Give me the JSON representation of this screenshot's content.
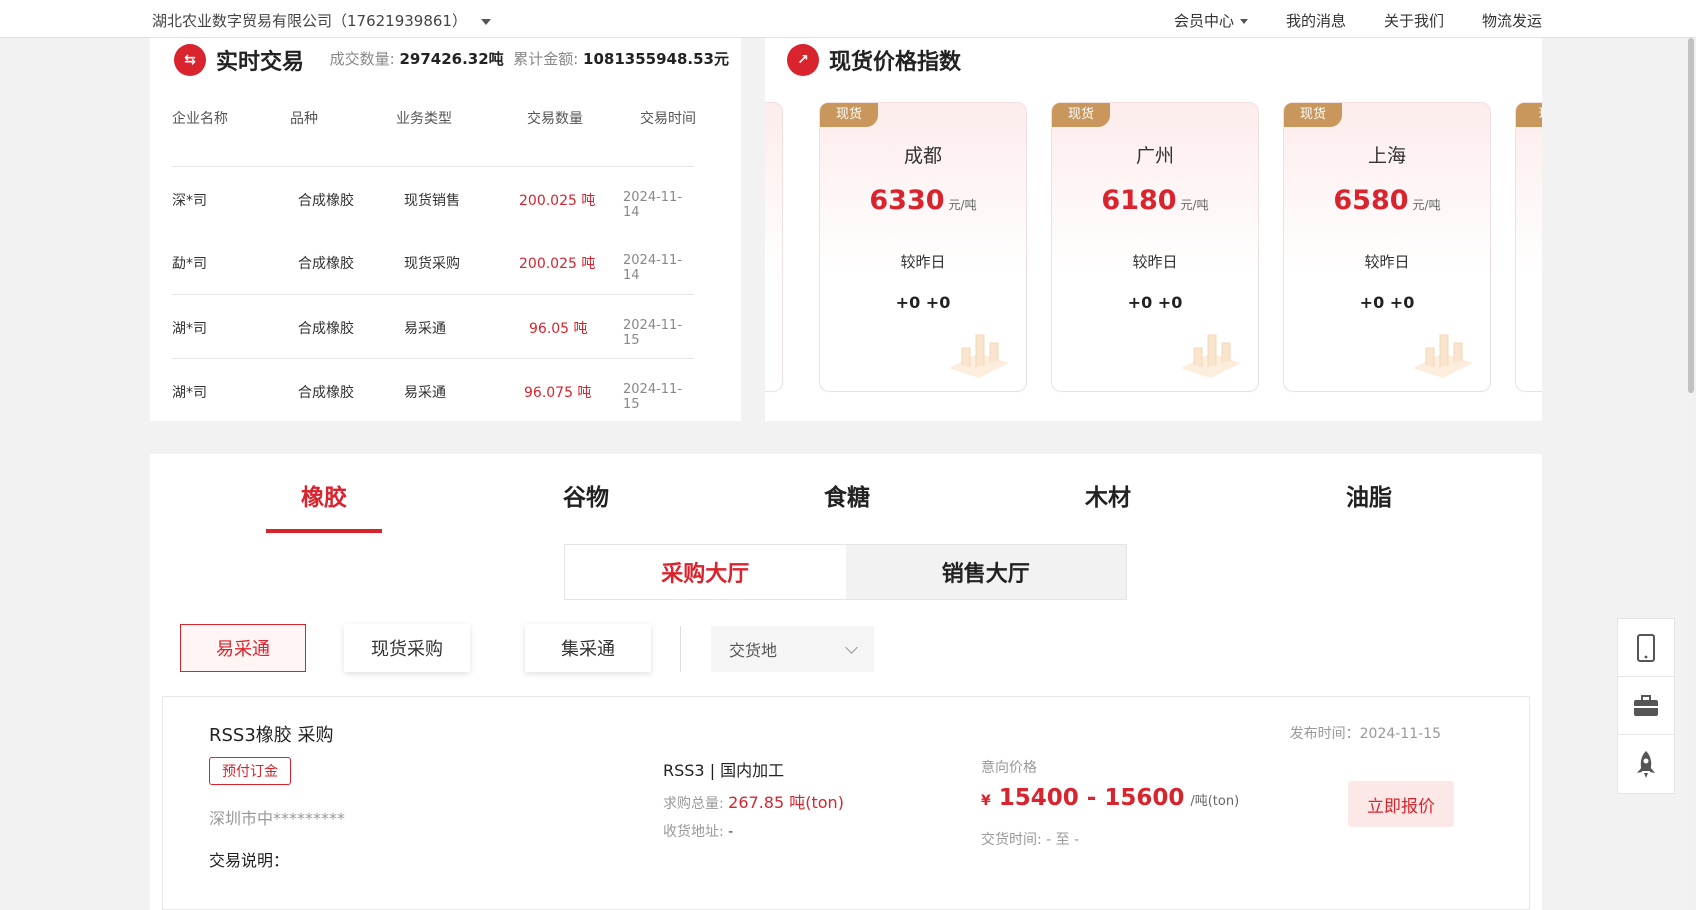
{
  "topbar": {
    "company": "湖北农业数字贸易有限公司（17621939861）",
    "nav": [
      "会员中心",
      "我的消息",
      "关于我们",
      "物流发运"
    ]
  },
  "trade": {
    "title": "实时交易",
    "volume_label": "成交数量:",
    "volume_value": "297426.32吨",
    "amount_label": "累计金额:",
    "amount_value": "1081355948.53元",
    "headers": [
      "企业名称",
      "品种",
      "业务类型",
      "交易数量",
      "交易时间"
    ],
    "rows": [
      {
        "company": "深*司",
        "variety": "合成橡胶",
        "type": "现货销售",
        "qty": "200.025 吨",
        "date": "2024-11-14"
      },
      {
        "company": "勐*司",
        "variety": "合成橡胶",
        "type": "现货采购",
        "qty": "200.025 吨",
        "date": "2024-11-14"
      },
      {
        "company": "湖*司",
        "variety": "合成橡胶",
        "type": "易采通",
        "qty": "96.05 吨",
        "date": "2024-11-15"
      },
      {
        "company": "湖*司",
        "variety": "合成橡胶",
        "type": "易采通",
        "qty": "96.075 吨",
        "date": "2024-11-15"
      }
    ]
  },
  "price_index": {
    "title": "现货价格指数",
    "cards": [
      {
        "tag": "现货",
        "city": "成都",
        "price": "6330",
        "unit": "元/吨",
        "compare": "较昨日",
        "change": "+0 +0"
      },
      {
        "tag": "现货",
        "city": "广州",
        "price": "6180",
        "unit": "元/吨",
        "compare": "较昨日",
        "change": "+0 +0"
      },
      {
        "tag": "现货",
        "city": "上海",
        "price": "6580",
        "unit": "元/吨",
        "compare": "较昨日",
        "change": "+0 +0"
      }
    ],
    "partial_tag": "现"
  },
  "categories": [
    "橡胶",
    "谷物",
    "食糖",
    "木材",
    "油脂"
  ],
  "halls": [
    "采购大厅",
    "销售大厅"
  ],
  "subtabs": [
    "易采通",
    "现货采购",
    "集采通"
  ],
  "delivery_select": "交货地",
  "listing": {
    "title": "RSS3橡胶 采购",
    "badge": "预付订金",
    "company": "深圳市中*********",
    "desc_label": "交易说明：",
    "spec": "RSS3 | 国内加工",
    "qty_label": "求购总量:",
    "qty_value": "267.85 吨(ton)",
    "addr_label": "收货地址:",
    "addr_value": "-",
    "price_label": "意向价格",
    "currency": "¥",
    "price_value": "15400 - 15600",
    "price_unit": "/吨(ton)",
    "delivery_time": "交货时间: - 至 -",
    "publish_time": "发布时间：2024-11-15",
    "button": "立即报价"
  },
  "colors": {
    "accent": "#d9232d",
    "tag": "#c9975c"
  }
}
